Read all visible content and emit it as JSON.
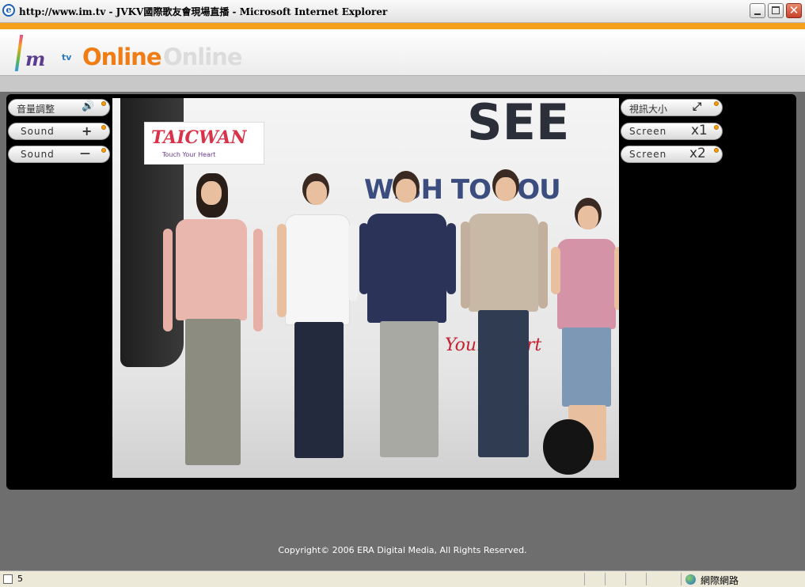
{
  "window": {
    "title": "http://www.im.tv - JVKV國際歌友會現場直播 - Microsoft Internet Explorer",
    "minimize_glyph": "_",
    "close_glyph": "✕"
  },
  "header": {
    "logo_mark": "m",
    "logo_tv": "tv",
    "logo_text": "Online",
    "logo_ghost": "Online"
  },
  "controls_left": [
    {
      "label": "音量調整",
      "icon": "speaker-icon",
      "symbol": "🔊"
    },
    {
      "label": "Sound",
      "icon": "plus-icon",
      "symbol": "+"
    },
    {
      "label": "Sound",
      "icon": "minus-icon",
      "symbol": "—"
    }
  ],
  "controls_right": [
    {
      "label": "視訊大小",
      "icon": "resize-icon",
      "symbol": "⤢"
    },
    {
      "label": "Screen",
      "symbol": "x1"
    },
    {
      "label": "Screen",
      "symbol": "x2"
    }
  ],
  "video": {
    "bg_text_see": "SEE",
    "bg_text_wish": "WISH TO YOU",
    "logo_text": "TAICWAN",
    "logo_sub": "Touch Your Heart",
    "bg_text_heart": "Your Heart"
  },
  "footer": {
    "copyright": "Copyright© 2006 ERA Digital Media, All Rights Reserved."
  },
  "statusbar": {
    "text": "5",
    "zone": "網際網路"
  },
  "colors": {
    "accent": "#f5a01d",
    "page_bg": "#6e6e6e",
    "stage_bg": "#000000",
    "dot": "#f4a00c"
  }
}
